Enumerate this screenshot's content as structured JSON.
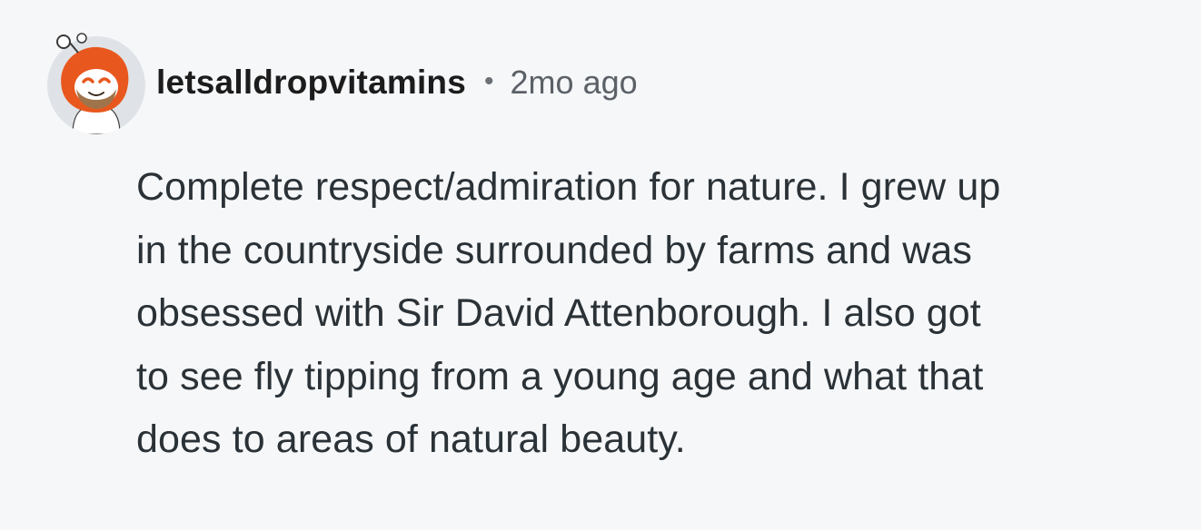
{
  "comment": {
    "author": "letsalldropvitamins",
    "separator": "•",
    "timestamp": "2mo ago",
    "avatar_icon": "snoo-avatar-icon",
    "body_lines": [
      "Complete respect/admiration for nature. I grew up",
      "in the countryside surrounded by farms and was",
      "obsessed with Sir David Attenborough. I also got",
      "to see fly tipping from a young age and what that",
      "does to areas of natural beauty."
    ]
  },
  "colors": {
    "background": "#f6f7f9",
    "username": "#1c1c1c",
    "meta": "#5b6167",
    "body_text": "#2a3237",
    "avatar_accent": "#e8581e"
  }
}
